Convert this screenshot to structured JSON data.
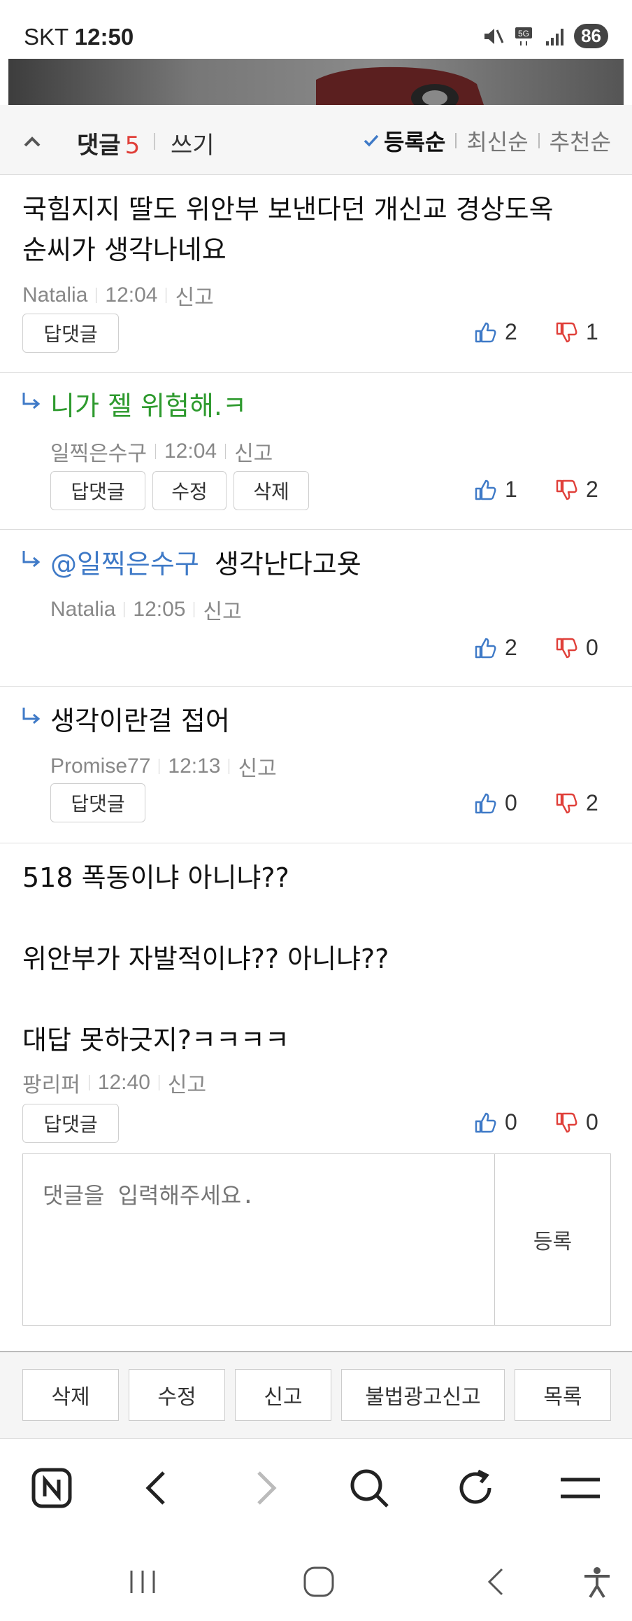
{
  "status_bar": {
    "carrier": "SKT",
    "time": "12:50",
    "battery": "86",
    "network": "5G"
  },
  "comments_header": {
    "title": "댓글",
    "count": "5",
    "write": "쓰기",
    "sort": {
      "registered": "등록순",
      "latest": "최신순",
      "recommended": "추천순"
    }
  },
  "comments": [
    {
      "text_line1": "국힘지지 딸도 위안부 보낸다던 개신교 경상도옥",
      "text_line2": "순씨가 생각나네요",
      "author": "Natalia",
      "time": "12:04",
      "report": "신고",
      "reply_btn": "답댓글",
      "likes": "2",
      "dislikes": "1"
    },
    {
      "text": "니가 젤 위험해.ㅋ",
      "author": "일찍은수구",
      "time": "12:04",
      "report": "신고",
      "reply_btn": "답댓글",
      "edit_btn": "수정",
      "delete_btn": "삭제",
      "likes": "1",
      "dislikes": "2"
    },
    {
      "mention": "@일찍은수구",
      "text": "생각난다고욧",
      "author": "Natalia",
      "time": "12:05",
      "report": "신고",
      "likes": "2",
      "dislikes": "0"
    },
    {
      "text": "생각이란걸 접어",
      "author": "Promise77",
      "time": "12:13",
      "report": "신고",
      "reply_btn": "답댓글",
      "likes": "0",
      "dislikes": "2"
    },
    {
      "line1": "518 폭동이냐 아니냐??",
      "line2": "위안부가 자발적이냐?? 아니냐??",
      "line3": "대답 못하긋지?ㅋㅋㅋㅋ",
      "author": "팡리퍼",
      "time": "12:40",
      "report": "신고",
      "reply_btn": "답댓글",
      "likes": "0",
      "dislikes": "0"
    }
  ],
  "comment_input": {
    "placeholder": "댓글을 입력해주세요.",
    "submit": "등록"
  },
  "actions": {
    "delete": "삭제",
    "edit": "수정",
    "report": "신고",
    "illegal_ad_report": "불법광고신고",
    "list": "목록"
  },
  "colors": {
    "accent_blue": "#3f7ac7",
    "dislike_red": "#e0403a",
    "reply_green": "#2e9a2e"
  }
}
